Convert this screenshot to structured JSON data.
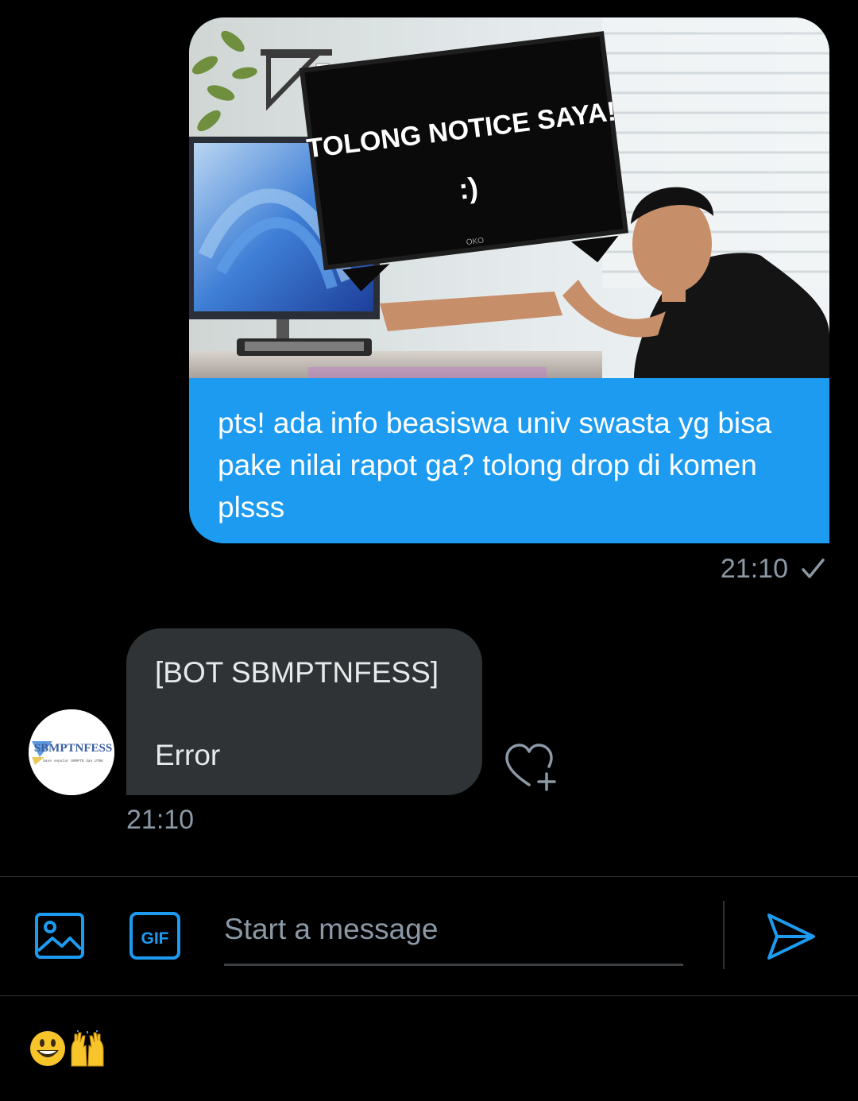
{
  "sent_message": {
    "image_caption_line1": "TOLONG NOTICE SAYA!",
    "image_caption_line2": ":)",
    "tv_brand": "OKO",
    "text": "pts! ada info beasiswa univ swasta yg bisa pake nilai rapot ga? tolong drop di komen plsss",
    "time": "21:10",
    "status_icon": "check-icon"
  },
  "received_message": {
    "avatar_text": "SBMPTNFESS",
    "avatar_subtext": "base seputar SBMPTN dan UTBK",
    "text": "[BOT SBMPTNFESS]\n\nError",
    "time": "21:10",
    "reaction_icon": "heart-plus-icon"
  },
  "composer": {
    "placeholder": "Start a message",
    "value": "",
    "gif_label": "GIF",
    "image_icon": "image-icon",
    "send_icon": "send-icon"
  },
  "emoji_strip": [
    "smiley-emoji",
    "raised-hands-emoji"
  ],
  "colors": {
    "background": "#000000",
    "sent_bubble": "#1d9bf0",
    "received_bubble": "#2f3336",
    "muted_text": "#8b98a5",
    "accent": "#1d9bf0"
  }
}
